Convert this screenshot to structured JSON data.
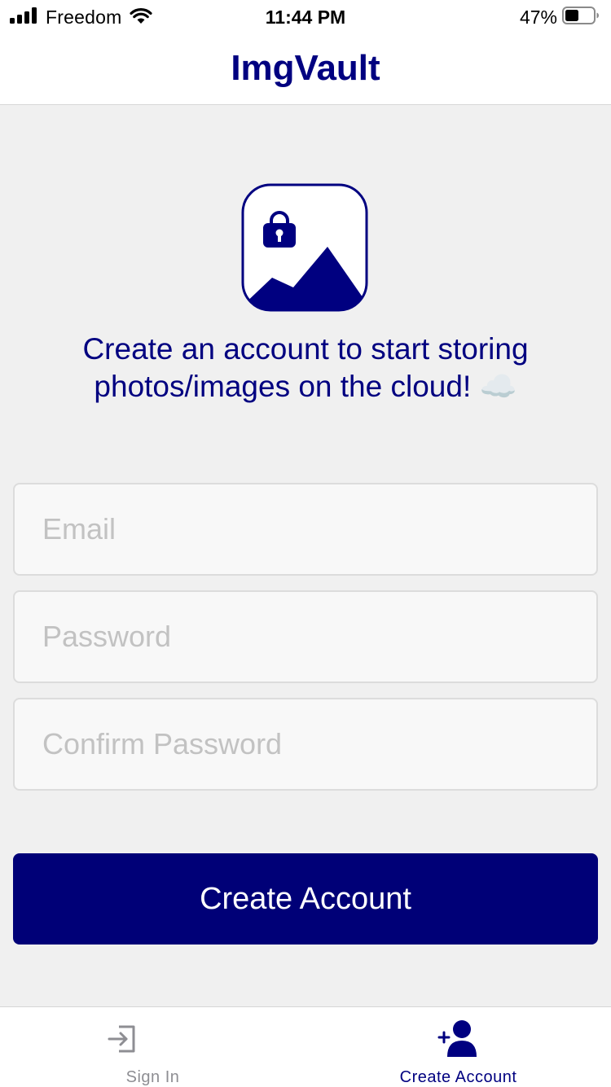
{
  "status_bar": {
    "carrier": "Freedom",
    "time": "11:44 PM",
    "battery_percent": "47%",
    "battery_level": 0.47,
    "icons": [
      "signal-bars-icon",
      "wifi-icon",
      "battery-icon"
    ]
  },
  "nav": {
    "title": "ImgVault"
  },
  "logo": {
    "icon": "image-lock-logo-icon"
  },
  "tagline": {
    "line1": "Create an account to start storing",
    "line2": "photos/images on the cloud! ☁️"
  },
  "form": {
    "email_placeholder": "Email",
    "password_placeholder": "Password",
    "confirm_placeholder": "Confirm Password",
    "email_value": "",
    "password_value": "",
    "confirm_value": "",
    "submit_label": "Create Account"
  },
  "tabs": [
    {
      "label": "Sign In",
      "icon": "sign-in-icon",
      "active": false
    },
    {
      "label": "Create Account",
      "icon": "add-user-icon",
      "active": true
    }
  ],
  "colors": {
    "accent": "#000080",
    "button": "#000077",
    "background": "#f0f0f0",
    "inactive_tab": "#8e8e93",
    "placeholder": "#c2c2c2"
  }
}
